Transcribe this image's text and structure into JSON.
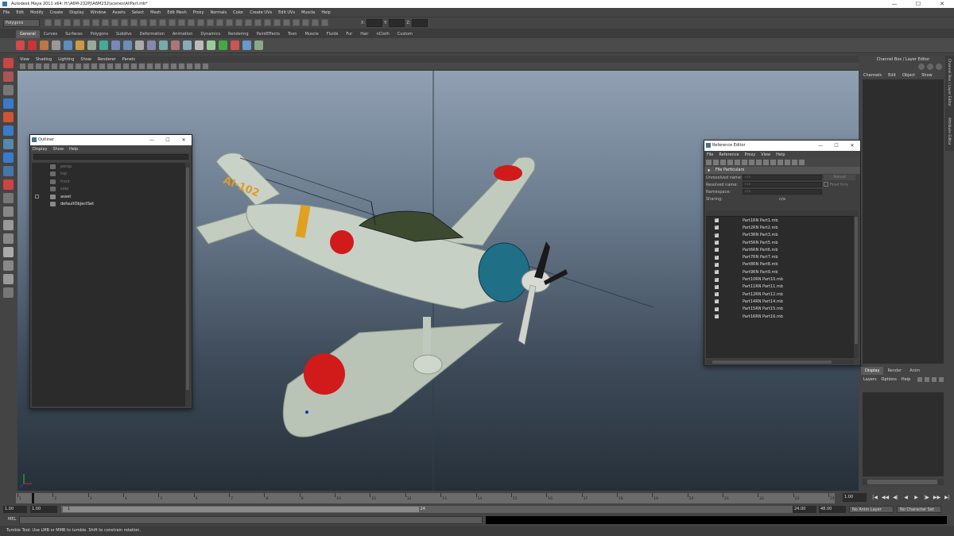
{
  "window": {
    "title": "Autodesk Maya 2011 x64: H:\\A6M-232PJ\\A6M232\\scenes\\AllPart.mb*",
    "buttons": [
      "—",
      "☐",
      "✕"
    ]
  },
  "menubar": [
    "File",
    "Edit",
    "Modify",
    "Create",
    "Display",
    "Window",
    "Assets",
    "Select",
    "Mesh",
    "Edit Mesh",
    "Proxy",
    "Normals",
    "Color",
    "Create UVs",
    "Edit UVs",
    "Muscle",
    "Help"
  ],
  "status_line": {
    "mode": "Polygons",
    "fields": [
      "X:",
      "Y:",
      "Z:"
    ]
  },
  "shelf": {
    "tabs": [
      "General",
      "Curves",
      "Surfaces",
      "Polygons",
      "Subdivs",
      "Deformation",
      "Animation",
      "Dynamics",
      "Rendering",
      "PaintEffects",
      "Toon",
      "Muscle",
      "Fluids",
      "Fur",
      "Hair",
      "nCloth",
      "Custom"
    ],
    "active_tab": "General"
  },
  "viewport": {
    "menu": [
      "View",
      "Shading",
      "Lighting",
      "Show",
      "Renderer",
      "Panels"
    ],
    "markings": {
      "tail_code": "AI-102"
    }
  },
  "outliner": {
    "title": "Outliner",
    "menu": [
      "Display",
      "Show",
      "Help"
    ],
    "items": [
      {
        "label": "persp",
        "dim": true,
        "expand": false
      },
      {
        "label": "top",
        "dim": true,
        "expand": false
      },
      {
        "label": "front",
        "dim": true,
        "expand": false
      },
      {
        "label": "side",
        "dim": true,
        "expand": false
      },
      {
        "label": "asset",
        "dim": false,
        "expand": true
      },
      {
        "label": "defaultObjectSet",
        "dim": false,
        "expand": false
      }
    ]
  },
  "reference_editor": {
    "title": "Reference Editor",
    "menu": [
      "File",
      "Reference",
      "Proxy",
      "View",
      "Help"
    ],
    "section": "File Particulars",
    "fields": [
      {
        "label": "Unresolved name:",
        "value": "n/a"
      },
      {
        "label": "Resolved name:",
        "value": "n/a"
      },
      {
        "label": "Namespace:",
        "value": "n/a"
      }
    ],
    "sharing_label": "Sharing:",
    "sharing_value": "n/a",
    "reload_button": "Reload",
    "read_only_label": "Read Only",
    "files": [
      "Part1RN Part1.mb",
      "Part2RN Part2.mb",
      "Part3RN Part3.mb",
      "Part5RN Part5.mb",
      "Part6RN Part6.mb",
      "Part7RN Part7.mb",
      "Part8RN Part8.mb",
      "Part9RN Part9.mb",
      "Part10RN Part10.mb",
      "Part11RN Part11.mb",
      "Part12RN Part12.mb",
      "Part14RN Part14.mb",
      "Part15RN Part15.mb",
      "Part16RN Part16.mb"
    ]
  },
  "channel_box": {
    "title": "Channel Box / Layer Editor",
    "menu": [
      "Channels",
      "Edit",
      "Object",
      "Show"
    ],
    "side_tabs": [
      "Channel Box / Layer Editor",
      "Attribute Editor"
    ]
  },
  "layer_editor": {
    "tabs": [
      "Display",
      "Render",
      "Anim"
    ],
    "active_tab": "Display",
    "menu": [
      "Layers",
      "Options",
      "Help"
    ]
  },
  "time_slider": {
    "ticks": [
      1,
      2,
      3,
      4,
      5,
      6,
      7,
      8,
      9,
      10,
      11,
      12,
      13,
      14,
      15,
      16,
      17,
      18,
      19,
      20,
      21,
      22,
      23,
      24
    ],
    "current_frame": "1.00",
    "playback": [
      "|◀",
      "◀◀",
      "◀|",
      "◀",
      "▶",
      "|▶",
      "▶▶",
      "▶|"
    ]
  },
  "range_slider": {
    "start": "1.00",
    "playback_start": "1.00",
    "range_start_label": "1",
    "range_end_label": "24",
    "playback_end": "24.00",
    "end": "48.00",
    "anim_layer": "No Anim Layer",
    "char_set": "No Character Set"
  },
  "command_line": {
    "label": "MEL"
  },
  "help_line": "Tumble Tool: Use LMB or MMB to tumble. Shift to constrain rotation.",
  "colors": {
    "accent": "#5b5b5b",
    "hinomaru": "#d11a1a",
    "cowling": "#1f6f86",
    "airframe": "#c7d0c4"
  }
}
